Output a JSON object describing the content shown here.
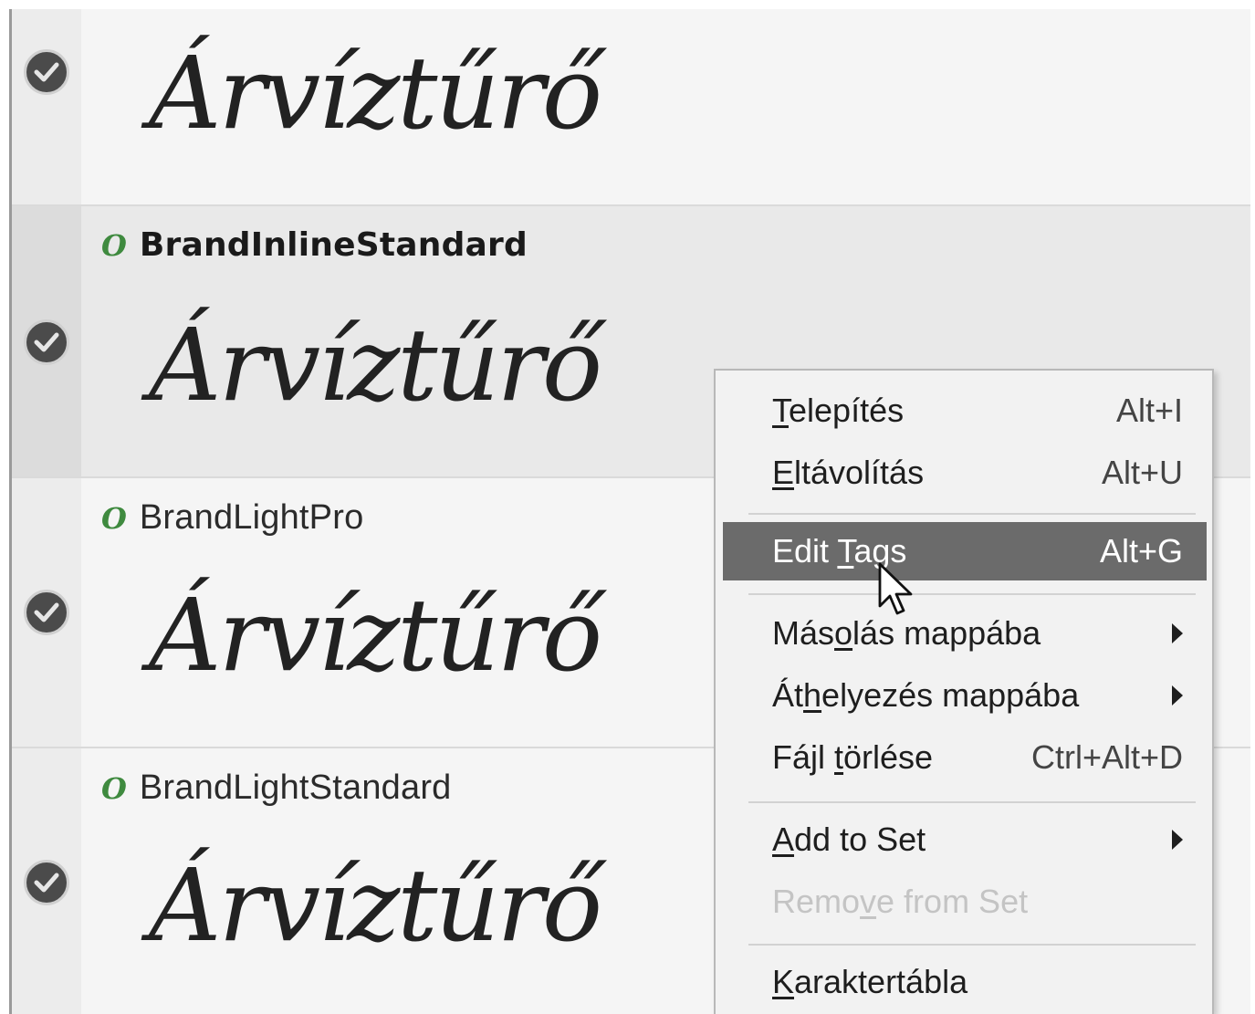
{
  "sample_text": "Árvíztűrő",
  "fonts": [
    {
      "name": ""
    },
    {
      "name": "BrandInlineStandard"
    },
    {
      "name": "BrandLightPro"
    },
    {
      "name": "BrandLightStandard"
    }
  ],
  "font_type_icon": "O",
  "context_menu": {
    "install": {
      "pre": "",
      "key": "T",
      "post": "elepítés",
      "shortcut": "Alt+I"
    },
    "uninstall": {
      "pre": "",
      "key": "E",
      "post": "ltávolítás",
      "shortcut": "Alt+U"
    },
    "edit_tags": {
      "pre": "Edit ",
      "key": "T",
      "post": "ags",
      "shortcut": "Alt+G"
    },
    "copy_to": {
      "pre": "Más",
      "key": "o",
      "post": "lás mappába"
    },
    "move_to": {
      "pre": "Át",
      "key": "h",
      "post": "elyezés mappába"
    },
    "delete_file": {
      "pre": "Fájl ",
      "key": "t",
      "post": "örlése",
      "shortcut": "Ctrl+Alt+D"
    },
    "add_to_set": {
      "pre": "",
      "key": "A",
      "post": "dd to Set"
    },
    "remove_from_set": {
      "pre": "Remo",
      "key": "v",
      "post": "e from Set"
    },
    "char_map": {
      "pre": "",
      "key": "K",
      "post": "araktertábla"
    }
  },
  "colors": {
    "selection": "#e9e9e9",
    "menu_highlight": "#6b6b6b",
    "otf_icon": "#3f8a3f"
  },
  "icons": {
    "check": "check-circle-icon",
    "submenu": "chevron-right-icon",
    "cursor": "mouse-pointer-icon",
    "font_type": "opentype-font-icon"
  }
}
